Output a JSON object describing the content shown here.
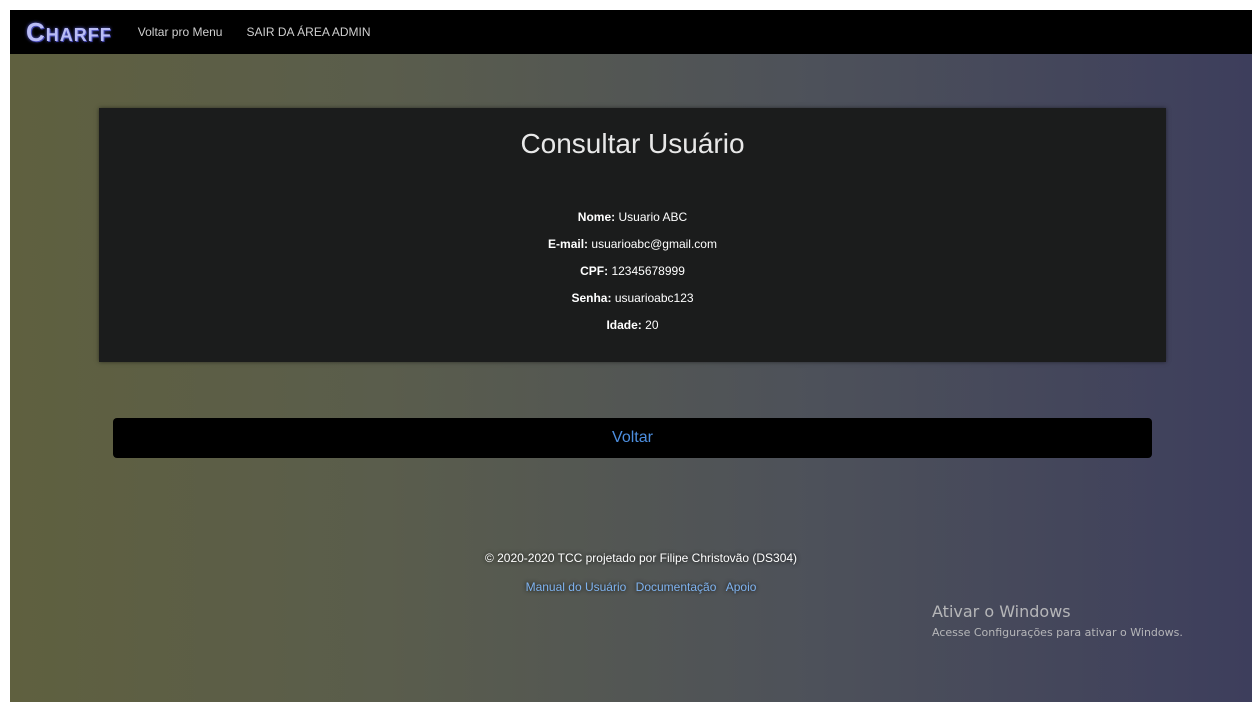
{
  "navbar": {
    "brand": "Charff",
    "links": [
      "Voltar pro Menu",
      "SAIR DA ÁREA ADMIN"
    ]
  },
  "card": {
    "title": "Consultar Usuário",
    "fields": [
      {
        "label": "Nome:",
        "value": "Usuario ABC"
      },
      {
        "label": "E-mail:",
        "value": "usuarioabc@gmail.com"
      },
      {
        "label": "CPF:",
        "value": "12345678999"
      },
      {
        "label": "Senha:",
        "value": "usuarioabc123"
      },
      {
        "label": "Idade:",
        "value": "20"
      }
    ]
  },
  "back_button": {
    "label": "Voltar"
  },
  "footer": {
    "copyright": "© 2020-2020 TCC projetado por Filipe Christovão (DS304)",
    "links": [
      "Manual do Usuário",
      "Documentação",
      "Apoio"
    ]
  },
  "windows_watermark": {
    "title": "Ativar o Windows",
    "subtitle": "Acesse Configurações para ativar o Windows."
  },
  "colors": {
    "brand": "#b9bcf5",
    "link": "#7fb3ef",
    "button_text": "#4d8fe0",
    "card_bg": "#1b1c1c"
  }
}
